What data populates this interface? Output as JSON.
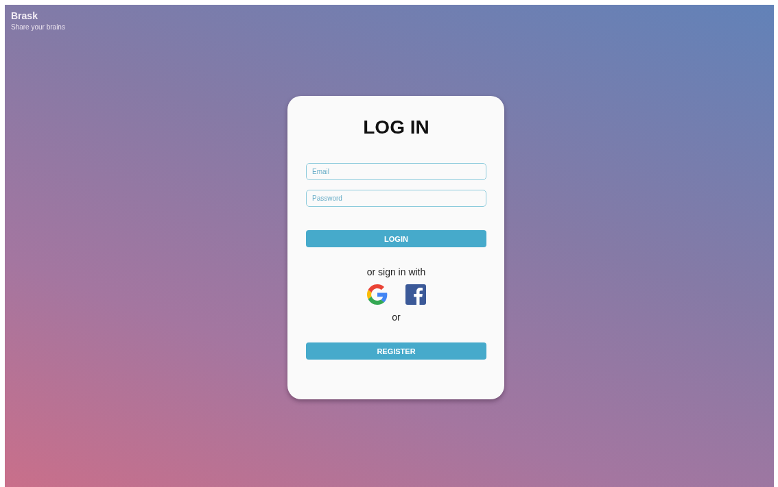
{
  "brand": {
    "title": "Brask",
    "subtitle": "Share your brains"
  },
  "card": {
    "title": "LOG IN",
    "fields": [
      {
        "placeholder": "Email"
      },
      {
        "placeholder": "Password"
      }
    ],
    "login_button": "LOGIN",
    "social_label": "or sign in with",
    "social": [
      {
        "kind": "google"
      },
      {
        "kind": "facebook"
      }
    ],
    "separator": "or",
    "register_button": "REGISTER"
  }
}
